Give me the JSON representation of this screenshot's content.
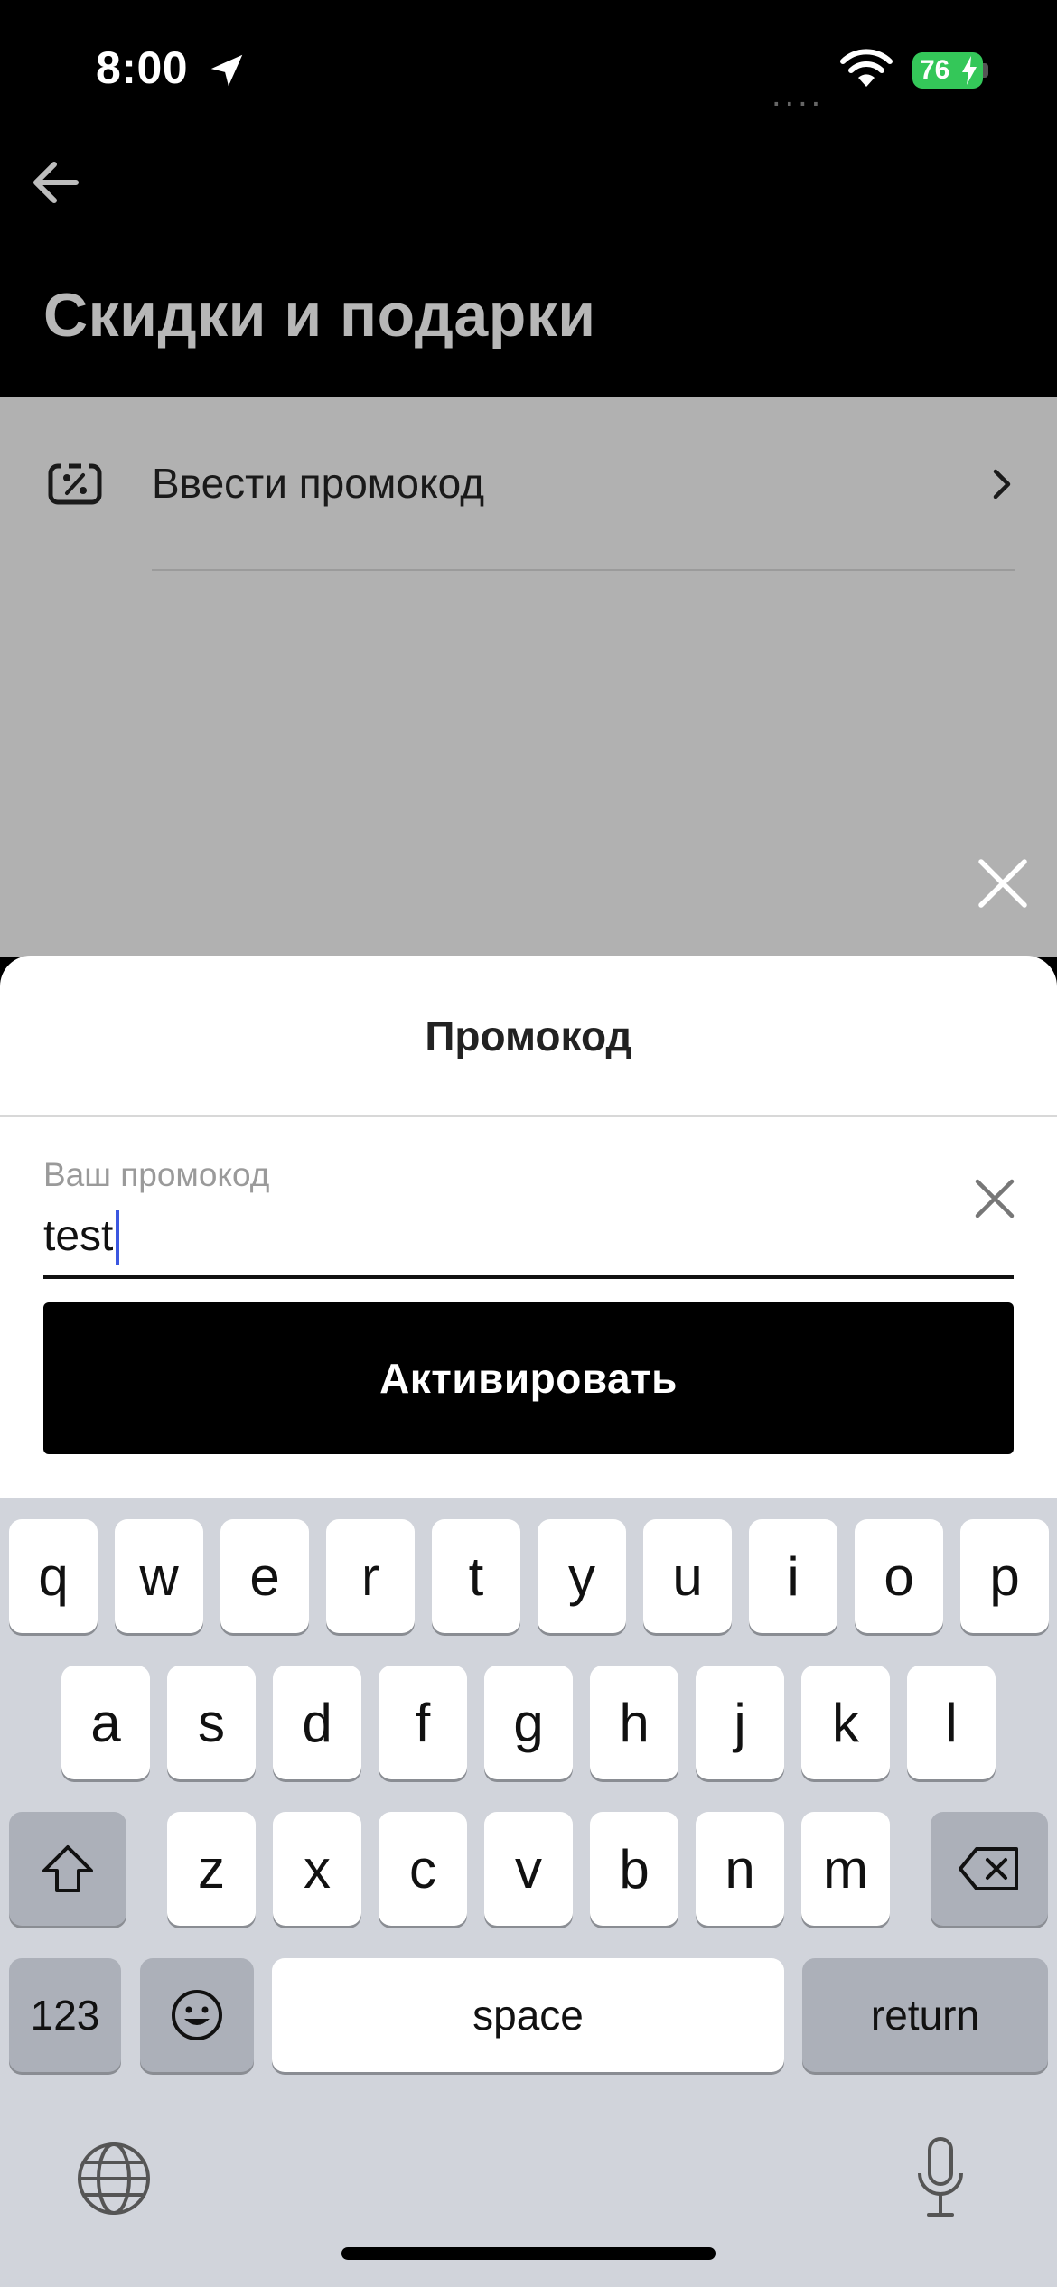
{
  "status_bar": {
    "time": "8:00",
    "signal": "....",
    "battery": "76"
  },
  "header": {
    "title": "Скидки и подарки"
  },
  "content": {
    "promo_row_label": "Ввести промокод"
  },
  "sheet": {
    "title": "Промокод",
    "input_label": "Ваш промокод",
    "input_value": "test",
    "activate_label": "Активировать"
  },
  "keyboard": {
    "row1": [
      "q",
      "w",
      "e",
      "r",
      "t",
      "y",
      "u",
      "i",
      "o",
      "p"
    ],
    "row2": [
      "a",
      "s",
      "d",
      "f",
      "g",
      "h",
      "j",
      "k",
      "l"
    ],
    "row3": [
      "z",
      "x",
      "c",
      "v",
      "b",
      "n",
      "m"
    ],
    "numbers_label": "123",
    "space_label": "space",
    "return_label": "return"
  },
  "colors": {
    "accent_caret": "#3b57e0",
    "battery_green": "#34c759"
  }
}
